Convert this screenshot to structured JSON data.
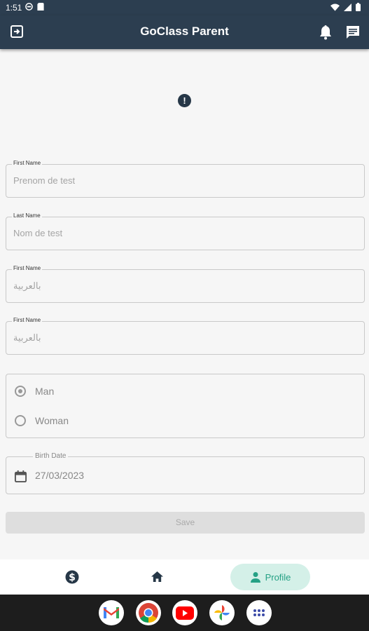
{
  "status_bar": {
    "time": "1:51"
  },
  "app_bar": {
    "title": "GoClass Parent"
  },
  "alert_glyph": "!",
  "form": {
    "first_name": {
      "label": "First Name",
      "placeholder": "Prenom de test"
    },
    "last_name": {
      "label": "Last Name",
      "placeholder": "Nom de test"
    },
    "first_name_ar": {
      "label": "First Name",
      "placeholder": "بالعربية"
    },
    "last_name_ar": {
      "label": "First Name",
      "placeholder": "بالعربية"
    },
    "gender": {
      "options": [
        "Man",
        "Woman"
      ],
      "selected": "Man"
    },
    "birth_date": {
      "label": "Birth Date",
      "value": "27/03/2023"
    },
    "save_label": "Save"
  },
  "bottom_nav": {
    "profile_label": "Profile",
    "active": "Profile"
  },
  "colors": {
    "app_bar": "#2c3e50",
    "accent": "#25a185",
    "accent_bg": "#d4f0e8"
  },
  "dock_apps": [
    "gmail-icon",
    "chrome-icon",
    "youtube-icon",
    "photos-icon",
    "app-drawer-icon"
  ]
}
